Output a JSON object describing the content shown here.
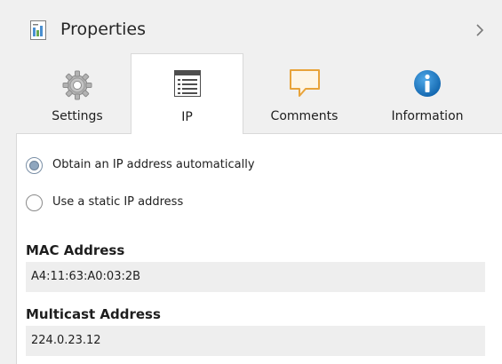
{
  "header": {
    "title": "Properties",
    "icon": "properties-icon",
    "collapse_icon": "chevron-right-icon"
  },
  "tabs": [
    {
      "label": "Settings",
      "icon": "gear-icon",
      "selected": false
    },
    {
      "label": "IP",
      "icon": "ip-config-icon",
      "selected": true
    },
    {
      "label": "Comments",
      "icon": "comment-icon",
      "selected": false
    },
    {
      "label": "Information",
      "icon": "info-icon",
      "selected": false
    }
  ],
  "ip": {
    "options": [
      {
        "label": "Obtain an IP address automatically",
        "checked": true
      },
      {
        "label": "Use a static IP address",
        "checked": false
      }
    ],
    "mac_label": "MAC Address",
    "mac_value": "A4:11:63:A0:03:2B",
    "multicast_label": "Multicast Address",
    "multicast_value": "224.0.23.12"
  },
  "colors": {
    "panel_bg": "#f0f0f0",
    "content_bg": "#ffffff",
    "field_bg": "#eeeeee",
    "info_blue": "#1a7dc4",
    "comment_orange": "#e8a33a"
  }
}
